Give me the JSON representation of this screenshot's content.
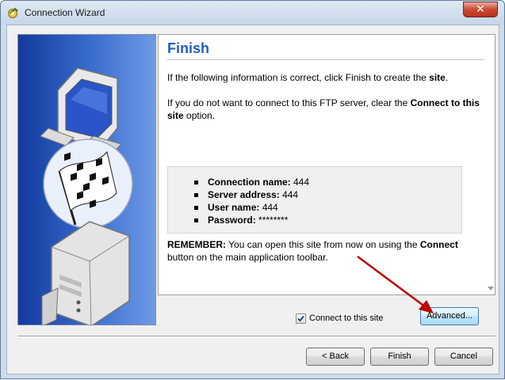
{
  "window": {
    "title": "Connection Wizard",
    "close_glyph": "✕"
  },
  "page": {
    "heading": "Finish",
    "intro": {
      "before": "If the following information is correct, click Finish to create the ",
      "bold": "site",
      "after": "."
    },
    "clear_option": {
      "before": "If you do not want to connect to this FTP server, clear the ",
      "bold": "Connect to this site",
      "after": " option."
    },
    "details": [
      {
        "label": "Connection name:",
        "value": " 444"
      },
      {
        "label": "Server address:",
        "value": " 444"
      },
      {
        "label": "User name:",
        "value": " 444"
      },
      {
        "label": "Password:",
        "value": " ********"
      }
    ],
    "remember": {
      "bold": "REMEMBER:",
      "text1": " You can open this site from now on using the ",
      "bold2": "Connect",
      "text2": " button on the main application toolbar."
    }
  },
  "options": {
    "connect_checkbox_label": "Connect to this site",
    "connect_checked": true
  },
  "buttons": {
    "advanced": "Advanced...",
    "back": "< Back",
    "finish": "Finish",
    "cancel": "Cancel"
  },
  "colors": {
    "heading": "#1f5fbf",
    "annotation_arrow": "#c00000"
  },
  "icons": {
    "app": "connection-wizard-icon",
    "side_graphic": "computer-flag-server-illustration"
  }
}
